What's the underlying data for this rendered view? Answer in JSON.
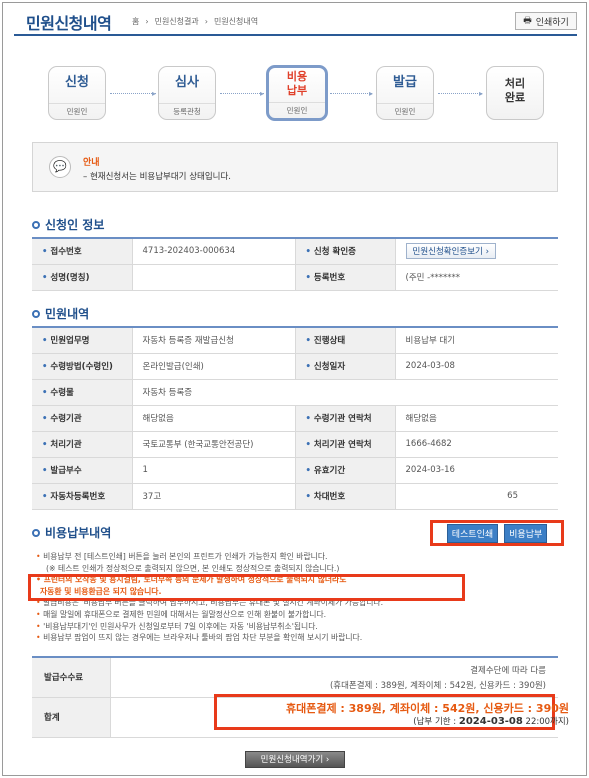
{
  "header": {
    "title": "민원신청내역",
    "breadcrumb": [
      "홈",
      "민원신청결과",
      "민원신청내역"
    ],
    "print_label": "인쇄하기"
  },
  "steps": [
    {
      "label": "신청",
      "sub": "민원인"
    },
    {
      "label": "심사",
      "sub": "등록관청"
    },
    {
      "label": "비용\n납부",
      "sub": "민원인"
    },
    {
      "label": "발급",
      "sub": "민원인"
    },
    {
      "label": "처리\n완료",
      "sub": ""
    }
  ],
  "notice": {
    "title": "안내",
    "text": "– 현재신청서는 비용납부대기 상태입니다."
  },
  "applicant": {
    "section_title": "신청인 정보",
    "receipt_no_label": "접수번호",
    "receipt_no": "4713-202403-000634",
    "confirm_label": "신청 확인증",
    "confirm_button": "민원신청확인증보기",
    "name_label": "성명(명칭)",
    "name": "",
    "regno_label": "등록번호",
    "regno": "(주민             -*******"
  },
  "petition": {
    "section_title": "민원내역",
    "rows": [
      {
        "k1": "민원업무명",
        "v1": "자동차 등록증 재발급신청",
        "k2": "진행상태",
        "v2": "비용납부 대기"
      },
      {
        "k1": "수령방법(수령인)",
        "v1": "온라인발급(인쇄)",
        "k2": "신청일자",
        "v2": "2024-03-08"
      },
      {
        "k1": "수령물",
        "v1": "자동차 등록증",
        "k2": "",
        "v2": ""
      },
      {
        "k1": "수령기관",
        "v1": "해당없음",
        "k2": "수령기관 연락처",
        "v2": "해당없음"
      },
      {
        "k1": "처리기관",
        "v1": "국토교통부 (한국교통안전공단)",
        "k2": "처리기관 연락처",
        "v2": "1666-4682"
      },
      {
        "k1": "발급부수",
        "v1": "1",
        "k2": "유효기간",
        "v2": "2024-03-16"
      },
      {
        "k1": "자동차등록번호",
        "v1": "37고",
        "k2": "차대번호",
        "v2": "65"
      }
    ]
  },
  "fee": {
    "section_title": "비용납부내역",
    "test_print_button": "테스트인쇄",
    "pay_button": "비용납부",
    "notes": [
      "비용납부 전 [테스트인쇄] 버튼을 눌러 본인의 프린트가 인쇄가 가능한지 확인 바랍니다.",
      "(※ 테스트 인쇄가 정상적으로 출력되지 않으면, 본 인쇄도 정상적으로 출력되지 않습니다.)",
      "프린터의 오작동 및 용지걸림, 토너부족 등의 문제가 발생하여 정상적으로 출력되지 않더라도",
      "자동환 및 비용환급은 되지 않습니다.",
      "발급비용은 '비용납부'버튼을 클릭하여 납부하시고, 비용납부는 휴대폰 및 실시간 계좌이체가 가능합니다.",
      "매월 말일에 휴대폰으로 결제한 민원에 대해서는 월말정산으로 인해 환불이 불가합니다.",
      "'비용납부대기'인 민원사무가 신청일로부터 7일 이후에는 자동 '비용납부취소'됩니다.",
      "비용납부 팝업이 뜨지 않는 경우에는 브라우저나 툴바의 팝업 차단 부분을 확인해 보시기 바랍니다."
    ],
    "fee_label": "발급수수료",
    "fee_line1": "결제수단에 따라 다름",
    "fee_line2": "(휴대폰결제 : 389원, 계좌이체 : 542원, 신용카드 : 390원)",
    "total_label": "합계",
    "total_amounts": "휴대폰결제 : 389원, 계좌이체 : 542원, 신용카드 : 390원",
    "deadline_prefix": "(납부 기한 : ",
    "deadline_date": "2024-03-08",
    "deadline_suffix": " 22:00까지)"
  },
  "back_button": "민원신청내역가기"
}
